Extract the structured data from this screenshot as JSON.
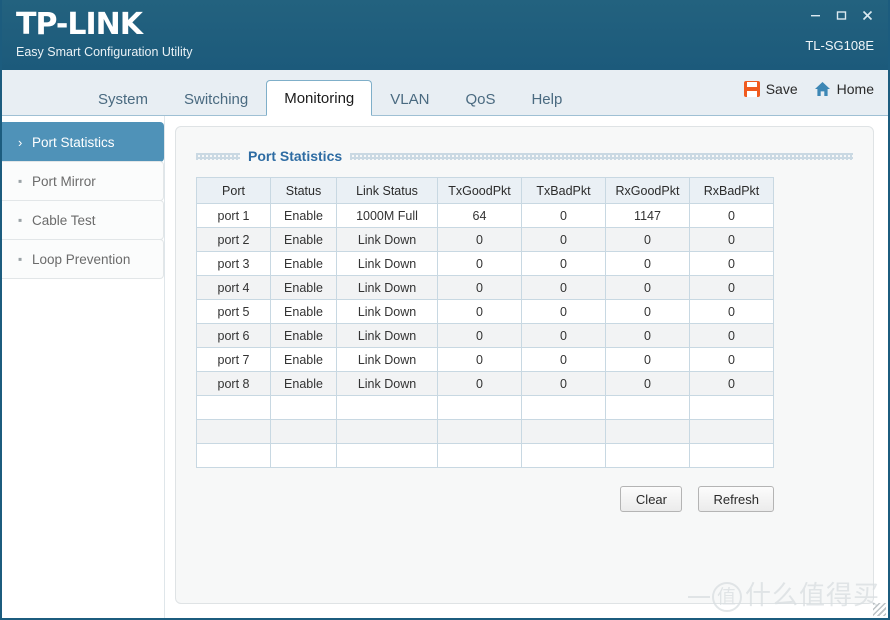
{
  "window": {
    "brand_logo": "TP-LINK",
    "brand_tagline": "Easy Smart Configuration Utility",
    "device_name": "TL-SG108E",
    "controls": {
      "minimize": "–",
      "maximize": "▫",
      "close": "✕"
    },
    "accent_color": "#1d5c7e",
    "active_sidebar_color": "#4f92b8",
    "save_icon_color": "#f05a1e",
    "home_icon_color": "#3d87b5",
    "title_link_color": "#2e6ca3"
  },
  "tabs": [
    {
      "label": "System",
      "active": false
    },
    {
      "label": "Switching",
      "active": false
    },
    {
      "label": "Monitoring",
      "active": true
    },
    {
      "label": "VLAN",
      "active": false
    },
    {
      "label": "QoS",
      "active": false
    },
    {
      "label": "Help",
      "active": false
    }
  ],
  "top_actions": [
    {
      "label": "Save",
      "icon": "save-icon"
    },
    {
      "label": "Home",
      "icon": "home-icon"
    }
  ],
  "sidebar": {
    "items": [
      {
        "label": "Port Statistics",
        "marker": "›",
        "active": true
      },
      {
        "label": "Port Mirror",
        "marker": "▪",
        "active": false
      },
      {
        "label": "Cable Test",
        "marker": "▪",
        "active": false
      },
      {
        "label": "Loop Prevention",
        "marker": "▪",
        "active": false
      }
    ]
  },
  "panel": {
    "title": "Port Statistics",
    "table": {
      "columns": [
        "Port",
        "Status",
        "Link Status",
        "TxGoodPkt",
        "TxBadPkt",
        "RxGoodPkt",
        "RxBadPkt"
      ],
      "rows": [
        [
          "port 1",
          "Enable",
          "1000M Full",
          "64",
          "0",
          "1147",
          "0"
        ],
        [
          "port 2",
          "Enable",
          "Link Down",
          "0",
          "0",
          "0",
          "0"
        ],
        [
          "port 3",
          "Enable",
          "Link Down",
          "0",
          "0",
          "0",
          "0"
        ],
        [
          "port 4",
          "Enable",
          "Link Down",
          "0",
          "0",
          "0",
          "0"
        ],
        [
          "port 5",
          "Enable",
          "Link Down",
          "0",
          "0",
          "0",
          "0"
        ],
        [
          "port 6",
          "Enable",
          "Link Down",
          "0",
          "0",
          "0",
          "0"
        ],
        [
          "port 7",
          "Enable",
          "Link Down",
          "0",
          "0",
          "0",
          "0"
        ],
        [
          "port 8",
          "Enable",
          "Link Down",
          "0",
          "0",
          "0",
          "0"
        ],
        [
          "",
          "",
          "",
          "",
          "",
          "",
          ""
        ],
        [
          "",
          "",
          "",
          "",
          "",
          "",
          ""
        ],
        [
          "",
          "",
          "",
          "",
          "",
          "",
          ""
        ]
      ]
    },
    "buttons": [
      {
        "label": "Clear",
        "name": "clear-button"
      },
      {
        "label": "Refresh",
        "name": "refresh-button"
      }
    ]
  },
  "watermark": {
    "circle_char": "值",
    "text": "什么值得买"
  }
}
